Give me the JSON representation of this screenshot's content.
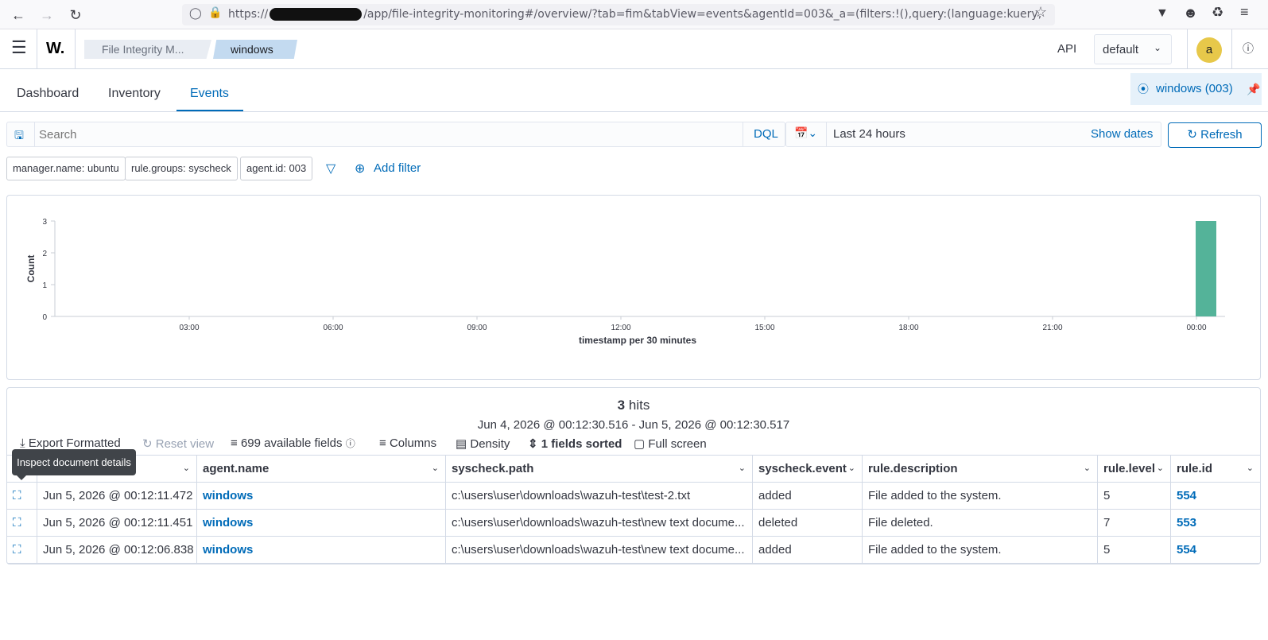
{
  "browser": {
    "url_prefix": "https://",
    "url_suffix": "/app/file-integrity-monitoring#/overview/?tab=fim&tabView=events&agentId=003&_a=(filters:!(),query:(language:kuery,"
  },
  "header": {
    "logo": "W.",
    "breadcrumbs": [
      "File Integrity M...",
      "windows"
    ],
    "api_label": "API",
    "space_select": "default",
    "avatar_initial": "a"
  },
  "tabs": [
    {
      "label": "Dashboard"
    },
    {
      "label": "Inventory"
    },
    {
      "label": "Events"
    }
  ],
  "agent_pill": {
    "label": "windows (003)"
  },
  "search": {
    "placeholder": "Search",
    "language": "DQL",
    "date_range": "Last 24 hours",
    "show_dates": "Show dates",
    "refresh": "Refresh"
  },
  "filters": [
    {
      "label": "manager.name: ubuntu"
    },
    {
      "label": "rule.groups: syscheck"
    },
    {
      "label": "agent.id: 003"
    }
  ],
  "add_filter": "Add filter",
  "chart_data": {
    "type": "bar",
    "xlabel": "timestamp per 30 minutes",
    "ylabel": "Count",
    "x_ticks": [
      "03:00",
      "06:00",
      "09:00",
      "12:00",
      "15:00",
      "18:00",
      "21:00",
      "00:00"
    ],
    "y_ticks": [
      "0",
      "1",
      "2",
      "3"
    ],
    "ylim": [
      0,
      3
    ],
    "bars": [
      {
        "x": "00:00",
        "value": 3
      }
    ],
    "colors": {
      "bar": "#54b399"
    }
  },
  "results": {
    "hits_count": "3",
    "hits_label": "hits",
    "range": "Jun 4, 2026 @ 00:12:30.516 - Jun 5, 2026 @ 00:12:30.517"
  },
  "toolbar": {
    "export": "Export Formatted",
    "reset": "Reset view",
    "fields": "699 available fields",
    "columns": "Columns",
    "density": "Density",
    "sorted": "1 fields sorted",
    "fullscreen": "Full screen"
  },
  "tooltip": "Inspect document details",
  "table": {
    "columns": [
      "timestamp",
      "agent.name",
      "syscheck.path",
      "syscheck.event",
      "rule.description",
      "rule.level",
      "rule.id"
    ],
    "rows": [
      {
        "timestamp": "Jun 5, 2026 @ 00:12:11.472",
        "agent": "windows",
        "path": "c:\\users\\user\\downloads\\wazuh-test\\test-2.txt",
        "event": "added",
        "description": "File added to the system.",
        "level": "5",
        "id": "554"
      },
      {
        "timestamp": "Jun 5, 2026 @ 00:12:11.451",
        "agent": "windows",
        "path": "c:\\users\\user\\downloads\\wazuh-test\\new text docume...",
        "event": "deleted",
        "description": "File deleted.",
        "level": "7",
        "id": "553"
      },
      {
        "timestamp": "Jun 5, 2026 @ 00:12:06.838",
        "agent": "windows",
        "path": "c:\\users\\user\\downloads\\wazuh-test\\new text docume...",
        "event": "added",
        "description": "File added to the system.",
        "level": "5",
        "id": "554"
      }
    ]
  }
}
